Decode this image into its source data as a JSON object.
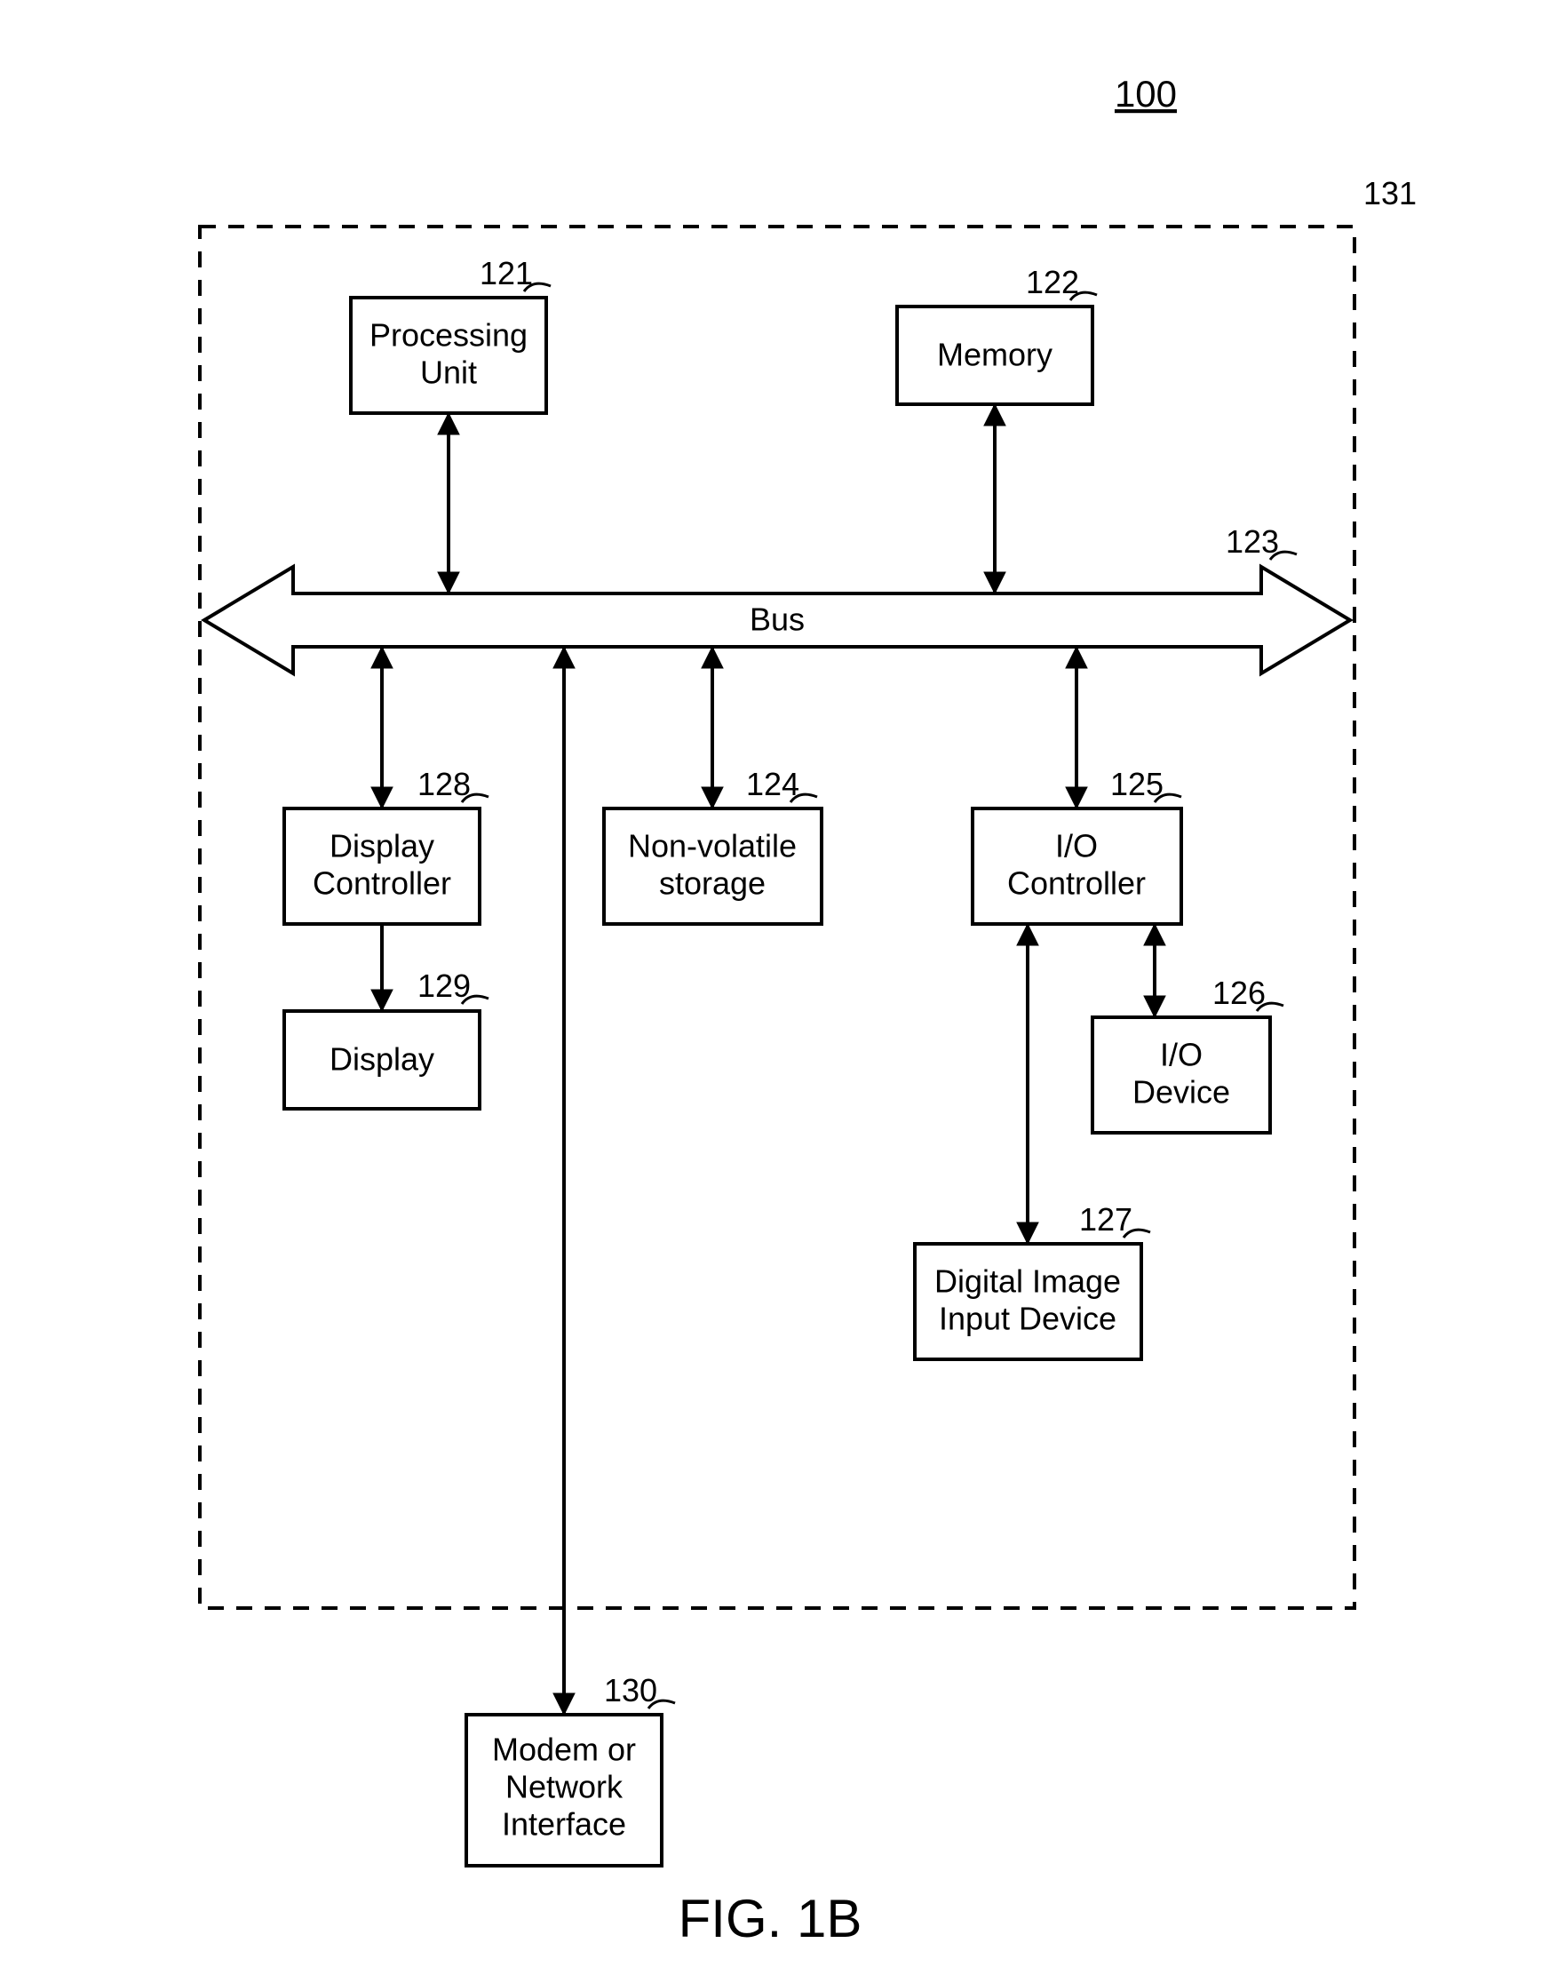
{
  "figure_ref": "100",
  "boundary_ref": "131",
  "figure_label": "FIG. 1B",
  "bus": {
    "ref": "123",
    "label": "Bus"
  },
  "blocks": {
    "processing_unit": {
      "ref": "121",
      "line1": "Processing",
      "line2": "Unit"
    },
    "memory": {
      "ref": "122",
      "line1": "Memory"
    },
    "display_ctrl": {
      "ref": "128",
      "line1": "Display",
      "line2": "Controller"
    },
    "display": {
      "ref": "129",
      "line1": "Display"
    },
    "nv_storage": {
      "ref": "124",
      "line1": "Non-volatile",
      "line2": "storage"
    },
    "io_ctrl": {
      "ref": "125",
      "line1": "I/O",
      "line2": "Controller"
    },
    "io_device": {
      "ref": "126",
      "line1": "I/O",
      "line2": "Device"
    },
    "dii_device": {
      "ref": "127",
      "line1": "Digital Image",
      "line2": "Input Device"
    },
    "modem": {
      "ref": "130",
      "line1": "Modem or",
      "line2": "Network",
      "line3": "Interface"
    }
  }
}
